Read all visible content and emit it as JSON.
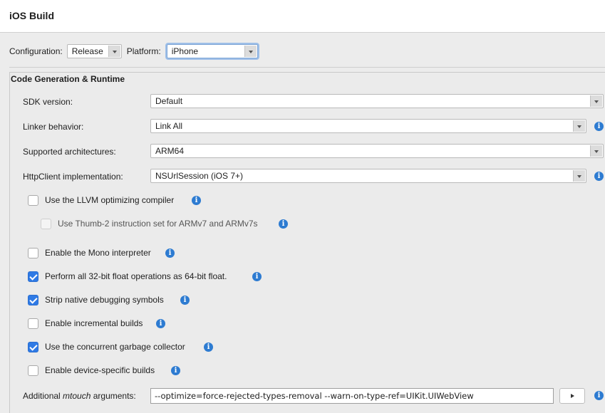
{
  "header": {
    "title": "iOS Build"
  },
  "config": {
    "configuration_label": "Configuration:",
    "configuration_value": "Release",
    "platform_label": "Platform:",
    "platform_value": "iPhone"
  },
  "section": {
    "title": "Code Generation & Runtime"
  },
  "fields": {
    "sdk_label": "SDK version:",
    "sdk_value": "Default",
    "linker_label": "Linker behavior:",
    "linker_value": "Link All",
    "arch_label": "Supported architectures:",
    "arch_value": "ARM64",
    "http_label": "HttpClient implementation:",
    "http_value": "NSUrlSession (iOS 7+)"
  },
  "options": [
    {
      "label": "Use the LLVM optimizing compiler",
      "checked": false,
      "enabled": true
    },
    {
      "label": "Use Thumb-2 instruction set for ARMv7 and ARMv7s",
      "checked": false,
      "enabled": false
    },
    {
      "label": "Enable the Mono interpreter",
      "checked": false,
      "enabled": true
    },
    {
      "label": "Perform all 32-bit float operations as 64-bit float.",
      "checked": true,
      "enabled": true
    },
    {
      "label": "Strip native debugging symbols",
      "checked": true,
      "enabled": true
    },
    {
      "label": "Enable incremental builds",
      "checked": false,
      "enabled": true
    },
    {
      "label": "Use the concurrent garbage collector",
      "checked": true,
      "enabled": true
    },
    {
      "label": "Enable device-specific builds",
      "checked": false,
      "enabled": true
    }
  ],
  "mtouch": {
    "label_prefix": "Additional ",
    "label_emph": "mtouch",
    "label_suffix": " arguments:",
    "value": "--optimize=force-rejected-types-removal --warn-on-type-ref=UIKit.UIWebView"
  },
  "icons": {
    "info": "info-icon",
    "run": "play-icon"
  },
  "colors": {
    "accent": "#2f7ae5",
    "info": "#2d7bd1"
  }
}
